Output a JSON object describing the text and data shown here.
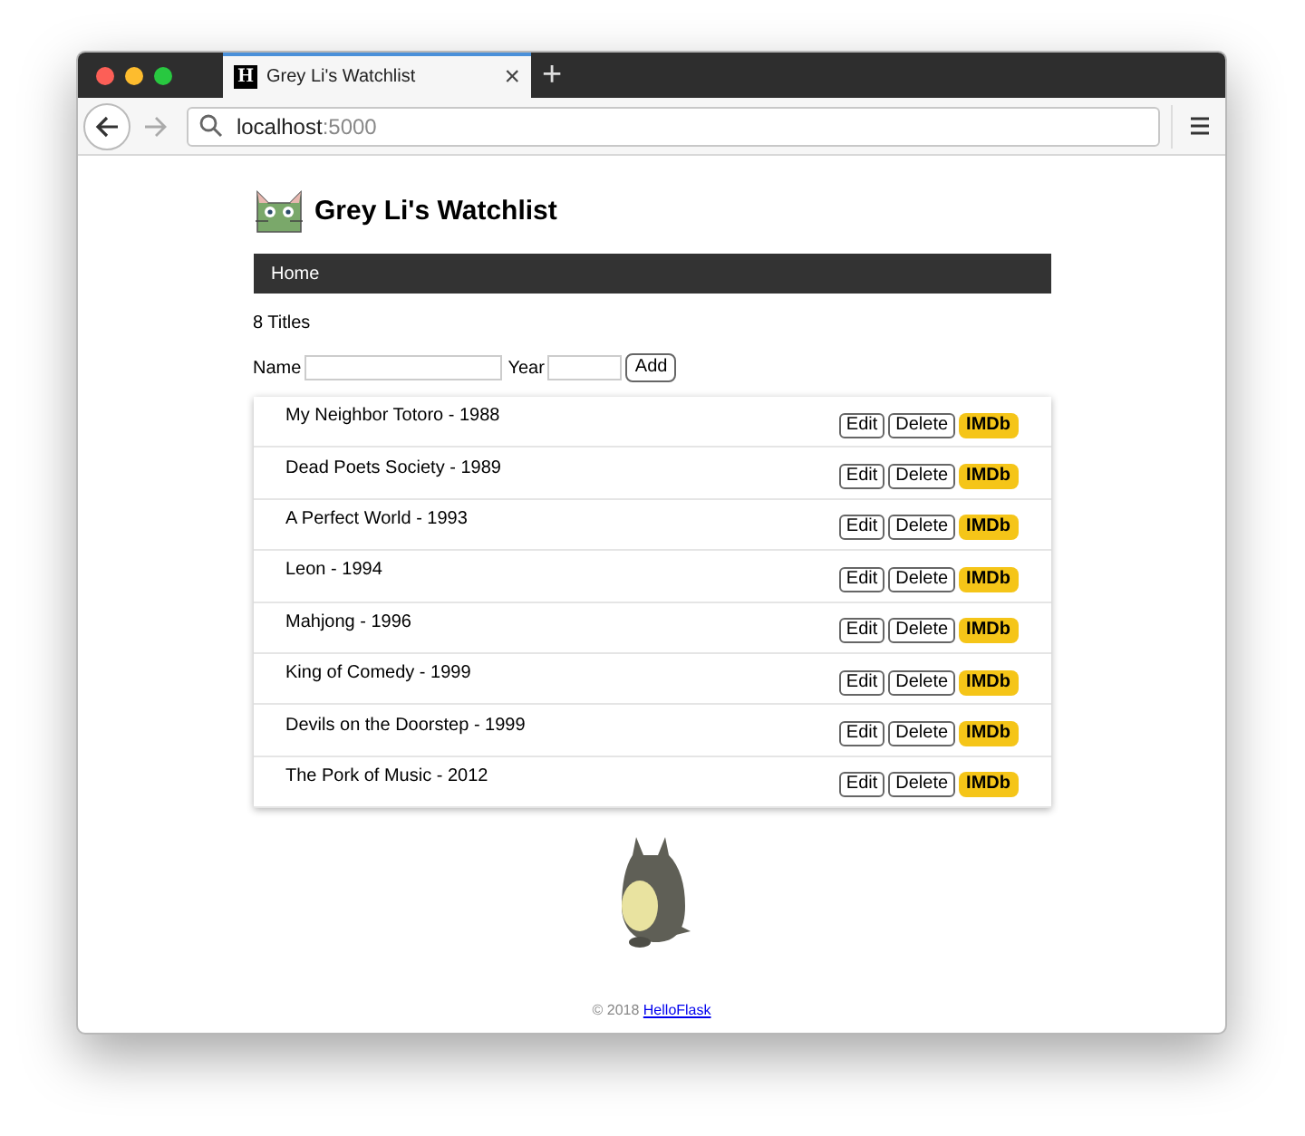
{
  "browser": {
    "tab": {
      "favicon": "H",
      "title": "Grey Li's Watchlist",
      "close": "×",
      "new_tab": "+"
    },
    "address": {
      "host": "localhost",
      "port": ":5000"
    }
  },
  "header": {
    "title": "Grey Li's Watchlist"
  },
  "nav": [
    {
      "label": "Home"
    }
  ],
  "count": "8 Titles",
  "form": {
    "name_label": "Name",
    "year_label": "Year",
    "button": "Add"
  },
  "movies": [
    {
      "title": "My Neighbor Totoro - 1988",
      "actions": [
        "Edit",
        "Delete",
        "IMDb"
      ]
    },
    {
      "title": "Dead Poets Society - 1989",
      "actions": [
        "Edit",
        "Delete",
        "IMDb"
      ]
    },
    {
      "title": "A Perfect World - 1993",
      "actions": [
        "Edit",
        "Delete",
        "IMDb"
      ]
    },
    {
      "title": "Leon - 1994",
      "actions": [
        "Edit",
        "Delete",
        "IMDb"
      ]
    },
    {
      "title": "Mahjong - 1996",
      "actions": [
        "Edit",
        "Delete",
        "IMDb"
      ]
    },
    {
      "title": "King of Comedy - 1999",
      "actions": [
        "Edit",
        "Delete",
        "IMDb"
      ]
    },
    {
      "title": "Devils on the Doorstep - 1999",
      "actions": [
        "Edit",
        "Delete",
        "IMDb"
      ]
    },
    {
      "title": "The Pork of Music - 2012",
      "actions": [
        "Edit",
        "Delete",
        "IMDb"
      ]
    }
  ],
  "footer": {
    "copyright": "© 2018",
    "link": "HelloFlask"
  }
}
